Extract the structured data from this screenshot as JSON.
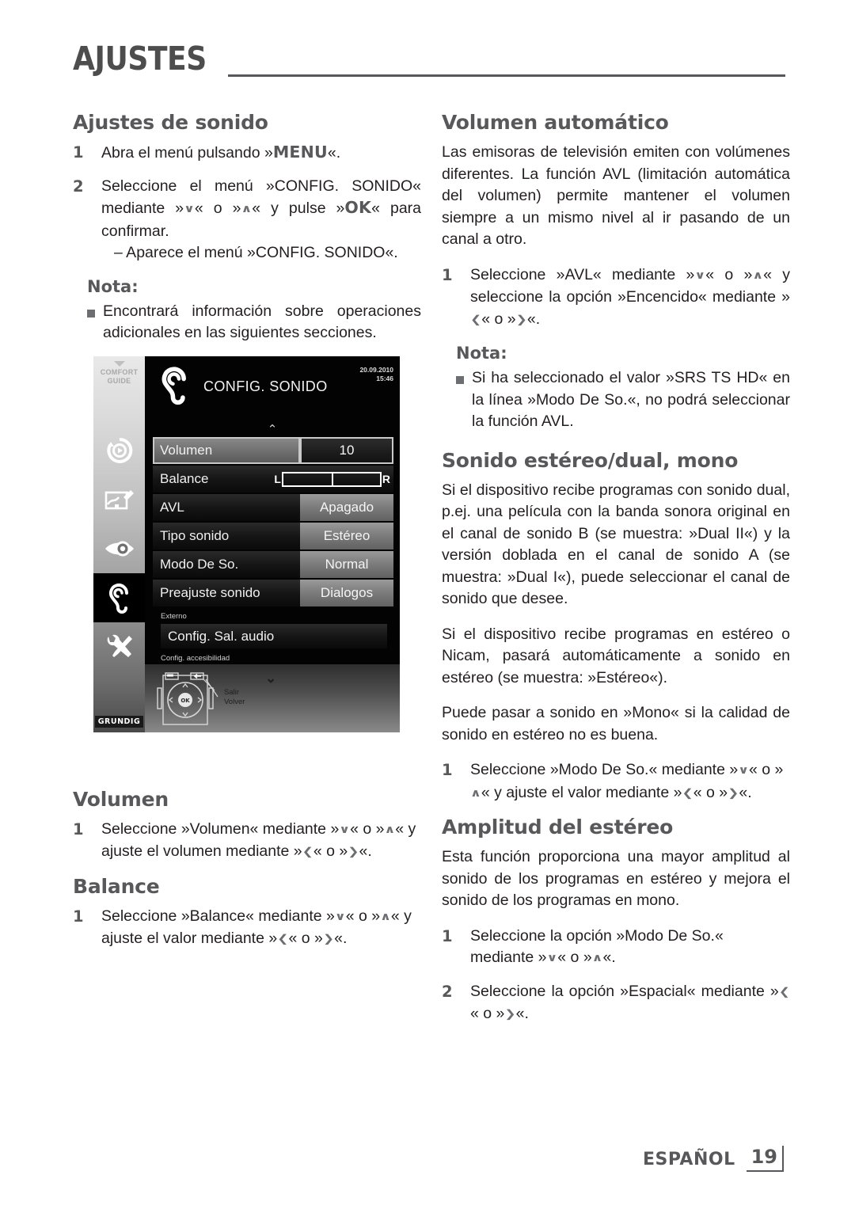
{
  "header": {
    "chapter": "AJUSTES"
  },
  "left": {
    "h_ajustes_sonido": "Ajustes de sonido",
    "step1_num": "1",
    "step1_a": "Abra el menú pulsando »",
    "step1_key": "MENU",
    "step1_b": "«.",
    "step2_num": "2",
    "step2_a": "Seleccione el menú »CONFIG. SONIDO« mediante »",
    "step2_arrow_down": "∨",
    "step2_b": "« o »",
    "step2_arrow_up": "∧",
    "step2_c": "« y pulse »",
    "step2_key": "OK",
    "step2_d": "« para confirmar.",
    "step2_sub": "– Aparece el menú »CONFIG. SONIDO«.",
    "nota_title": "Nota:",
    "nota_text": "Encontrará información sobre operaciones adicionales en las siguientes secciones.",
    "h_volumen": "Volumen",
    "vol_num": "1",
    "vol_a": "Seleccione »Volumen« mediante »",
    "vol_arrow_down": "∨",
    "vol_b": "« o »",
    "vol_arrow_up": "∧",
    "vol_c": "« y ajuste el volumen mediante »",
    "vol_arrow_left": "❮",
    "vol_d": "« o »",
    "vol_arrow_right": "❯",
    "vol_e": "«.",
    "h_balance": "Balance",
    "bal_num": "1",
    "bal_a": "Seleccione »Balance« mediante »",
    "bal_arrow_down": "∨",
    "bal_b": "« o »",
    "bal_arrow_up": "∧",
    "bal_c": "« y ajuste el valor mediante »",
    "bal_arrow_left": "❮",
    "bal_d": "« o »",
    "bal_arrow_right": "❯",
    "bal_e": "«."
  },
  "right": {
    "h_volumen_automatico": "Volumen automático",
    "p_avl": "Las emisoras de televisión emiten con volúmenes diferentes. La función AVL (limitación automática del volumen) permite mantener el volumen siempre a un mismo nivel al ir pasando de un canal a otro.",
    "avl_num": "1",
    "avl_a": "Seleccione »AVL« mediante »",
    "avl_arrow_down": "∨",
    "avl_b": "« o »",
    "avl_arrow_up": "∧",
    "avl_c": "« y seleccione la opción »Encencido« mediante »",
    "avl_arrow_left": "❮",
    "avl_d": "« o »",
    "avl_arrow_right": "❯",
    "avl_e": "«.",
    "nota_title": "Nota:",
    "nota_text": "Si ha seleccionado el valor »SRS TS HD« en la línea »Modo De So.«, no podrá seleccionar la función AVL.",
    "h_sonido_estereo": "Sonido estéreo/dual, mono",
    "p_dual": "Si el dispositivo recibe programas con sonido dual, p.ej. una película con la banda sonora original en el canal de sonido B (se muestra: »Dual II«) y la versión doblada en el canal de sonido A (se muestra: »Dual I«), puede seleccionar el canal de sonido que desee.",
    "p_nicam": "Si el dispositivo recibe programas en estéreo o Nicam, pasará automáticamente a sonido en estéreo (se muestra: »Estéreo«).",
    "p_mono": "Puede pasar a sonido en »Mono« si la calidad de sonido en estéreo no es buena.",
    "modo_num": "1",
    "modo_a": "Seleccione »Modo De So.« mediante »",
    "modo_arrow_down": "∨",
    "modo_b": "« o »",
    "modo_arrow_up": "∧",
    "modo_c": "« y ajuste el valor mediante »",
    "modo_arrow_left": "❮",
    "modo_d": "« o »",
    "modo_arrow_right": "❯",
    "modo_e": "«.",
    "h_amplitud": "Amplitud del estéreo",
    "p_amplitud": "Esta función proporciona una mayor amplitud al sonido de los programas en estéreo y mejora el sonido de los programas en mono.",
    "amp1_num": "1",
    "amp1_a": "Seleccione la opción »Modo De So.« mediante »",
    "amp1_arrow_down": "∨",
    "amp1_b": "« o »",
    "amp1_arrow_up": "∧",
    "amp1_c": "«.",
    "amp2_num": "2",
    "amp2_a": "Seleccione la opción »Espacial« mediante »",
    "amp2_arrow_left": "❮",
    "amp2_b": "« o »",
    "amp2_arrow_right": "❯",
    "amp2_c": "«."
  },
  "tv": {
    "rail_caption_line1": "COMFORT",
    "rail_caption_line2": "GUIDE",
    "brand": "GRUNDIG",
    "title": "CONFIG. SONIDO",
    "date": "20.09.2010",
    "time": "15:46",
    "rows": [
      {
        "label": "Volumen",
        "value": "10",
        "selected": true,
        "kind": "value"
      },
      {
        "label": "Balance",
        "value": "",
        "selected": false,
        "kind": "balance",
        "left_mark": "L",
        "right_mark": "R"
      },
      {
        "label": "AVL",
        "value": "Apagado",
        "selected": false,
        "kind": "value"
      },
      {
        "label": "Tipo sonido",
        "value": "Estéreo",
        "selected": false,
        "kind": "value"
      },
      {
        "label": "Modo De So.",
        "value": "Normal",
        "selected": false,
        "kind": "value"
      },
      {
        "label": "Preajuste sonido",
        "value": "Dialogos",
        "selected": false,
        "kind": "value"
      }
    ],
    "group_externo": "Externo",
    "wide_item": "Config. Sal. audio",
    "group_accesibilidad": "Config. accesibilidad",
    "ok_label": "OK",
    "legend_salir": "Salir",
    "legend_volver": "Volver"
  },
  "footer": {
    "language": "ESPAÑOL",
    "page": "19"
  },
  "colors": {
    "heading": "#58585a",
    "body_text": "#231f20",
    "rule": "#58585a",
    "bullet": "#6d6e71"
  }
}
